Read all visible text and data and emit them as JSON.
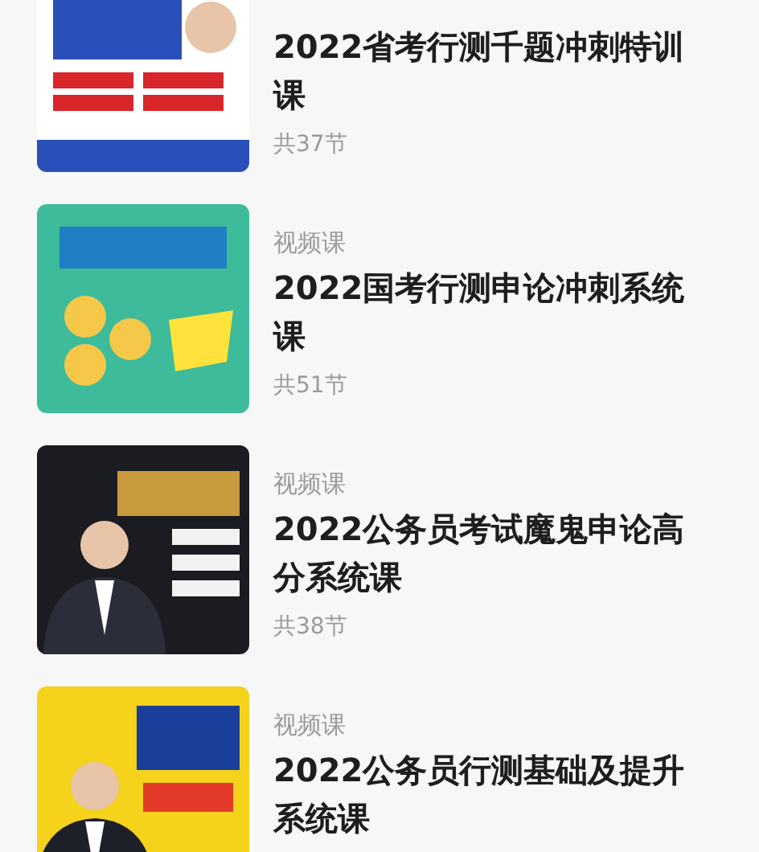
{
  "courses": [
    {
      "title": "2022省考行测千题冲刺特训课",
      "lessons": "共37节"
    },
    {
      "category": "视频课",
      "title": "2022国考行测申论冲刺系统课",
      "lessons": "共51节"
    },
    {
      "category": "视频课",
      "title": "2022公务员考试魔鬼申论高分系统课",
      "lessons": "共38节"
    },
    {
      "category": "视频课",
      "title": "2022公务员行测基础及提升系统课"
    }
  ]
}
